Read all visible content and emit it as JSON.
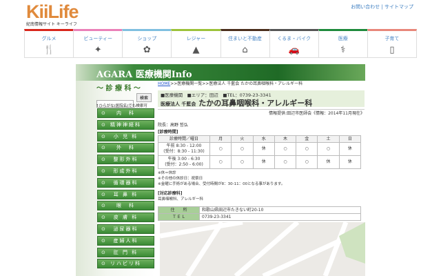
{
  "header": {
    "logo": "KiiLife",
    "tagline": "紀南情報サイト キーライフ",
    "links": "お問い合わせ | サイトマップ"
  },
  "nav": [
    {
      "label": "グルメ",
      "icon": "fork-knife-icon",
      "glyph": "🍴",
      "color": "#d9261c"
    },
    {
      "label": "ビューティー",
      "icon": "sparkle-icon",
      "glyph": "✦",
      "color": "#ea80b8"
    },
    {
      "label": "ショップ",
      "icon": "flower-icon",
      "glyph": "✿",
      "color": "#7fbfe0"
    },
    {
      "label": "レジャー",
      "icon": "tent-icon",
      "glyph": "▲",
      "color": "#9cc23a"
    },
    {
      "label": "住まいと不動産",
      "icon": "house-icon",
      "glyph": "⌂",
      "color": "#4a2e1c"
    },
    {
      "label": "くるま・バイク",
      "icon": "car-icon",
      "glyph": "🚗",
      "color": "#555555"
    },
    {
      "label": "医療",
      "icon": "stethoscope-icon",
      "glyph": "⚕",
      "color": "#1e8a3c"
    },
    {
      "label": "子育て",
      "icon": "bottle-icon",
      "glyph": "▯",
      "color": "#e8877a"
    }
  ],
  "banner": "AGARA 医療機関Info",
  "sidebar": {
    "heading": "～ 診 療 科 ～",
    "search_button": "検索",
    "search_value": "",
    "hint": "↑ひらがな(医院名)でも検索可",
    "depts": [
      "内　科",
      "精神神経科",
      "小 児 科",
      "外　科",
      "整形外科",
      "形成外科",
      "循環器科",
      "耳 鼻 科",
      "眼　科",
      "皮 膚 科",
      "泌尿器科",
      "産婦人科",
      "肛 門 科",
      "リハビリ科"
    ]
  },
  "main": {
    "breadcrumb": {
      "home": "HOME",
      "rest": ">>医療機関一覧>>医療法人 千藍会 たかの耳鼻咽喉科・アレルギー科"
    },
    "meta": {
      "type": "■医療機関",
      "area_label": "■エリア：",
      "area": "田辺",
      "tel": "■TEL：0739-23-3341"
    },
    "title_prefix": "医療法人 千藍会",
    "title": "たかの耳鼻咽喉科・アレルギー科",
    "source": "情報提供:田辺市医師会《情報：2014年11月現在》",
    "director": "院長：高野 哲弘",
    "hours_label": "[診療時間]",
    "hours_header": [
      "診療時間／曜日",
      "月",
      "火",
      "水",
      "木",
      "金",
      "土",
      "日"
    ],
    "hours_rows": [
      [
        "午前 8:30 - 12:00",
        "(受付：8:30 - 11:30)",
        "○",
        "○",
        "休",
        "○",
        "○",
        "○",
        "休"
      ],
      [
        "午後 3:00 - 6:30",
        "(受付：2:50 - 6:00)",
        "○",
        "○",
        "休",
        "○",
        "○",
        "休",
        "休"
      ]
    ],
    "notes": [
      "※休＝休診",
      "※その他の休診日：祝祭日",
      "※金曜に手術がある場合、受付時間が8：30-11：00となる事があります。"
    ],
    "dept_label": "[対応診療科]",
    "depts": "耳鼻咽喉科、アレルギー科",
    "address_label": "住　所",
    "address": "和歌山県田辺市たきない町20-10",
    "tel_label": "TEL",
    "tel": "0739-23-3341"
  }
}
